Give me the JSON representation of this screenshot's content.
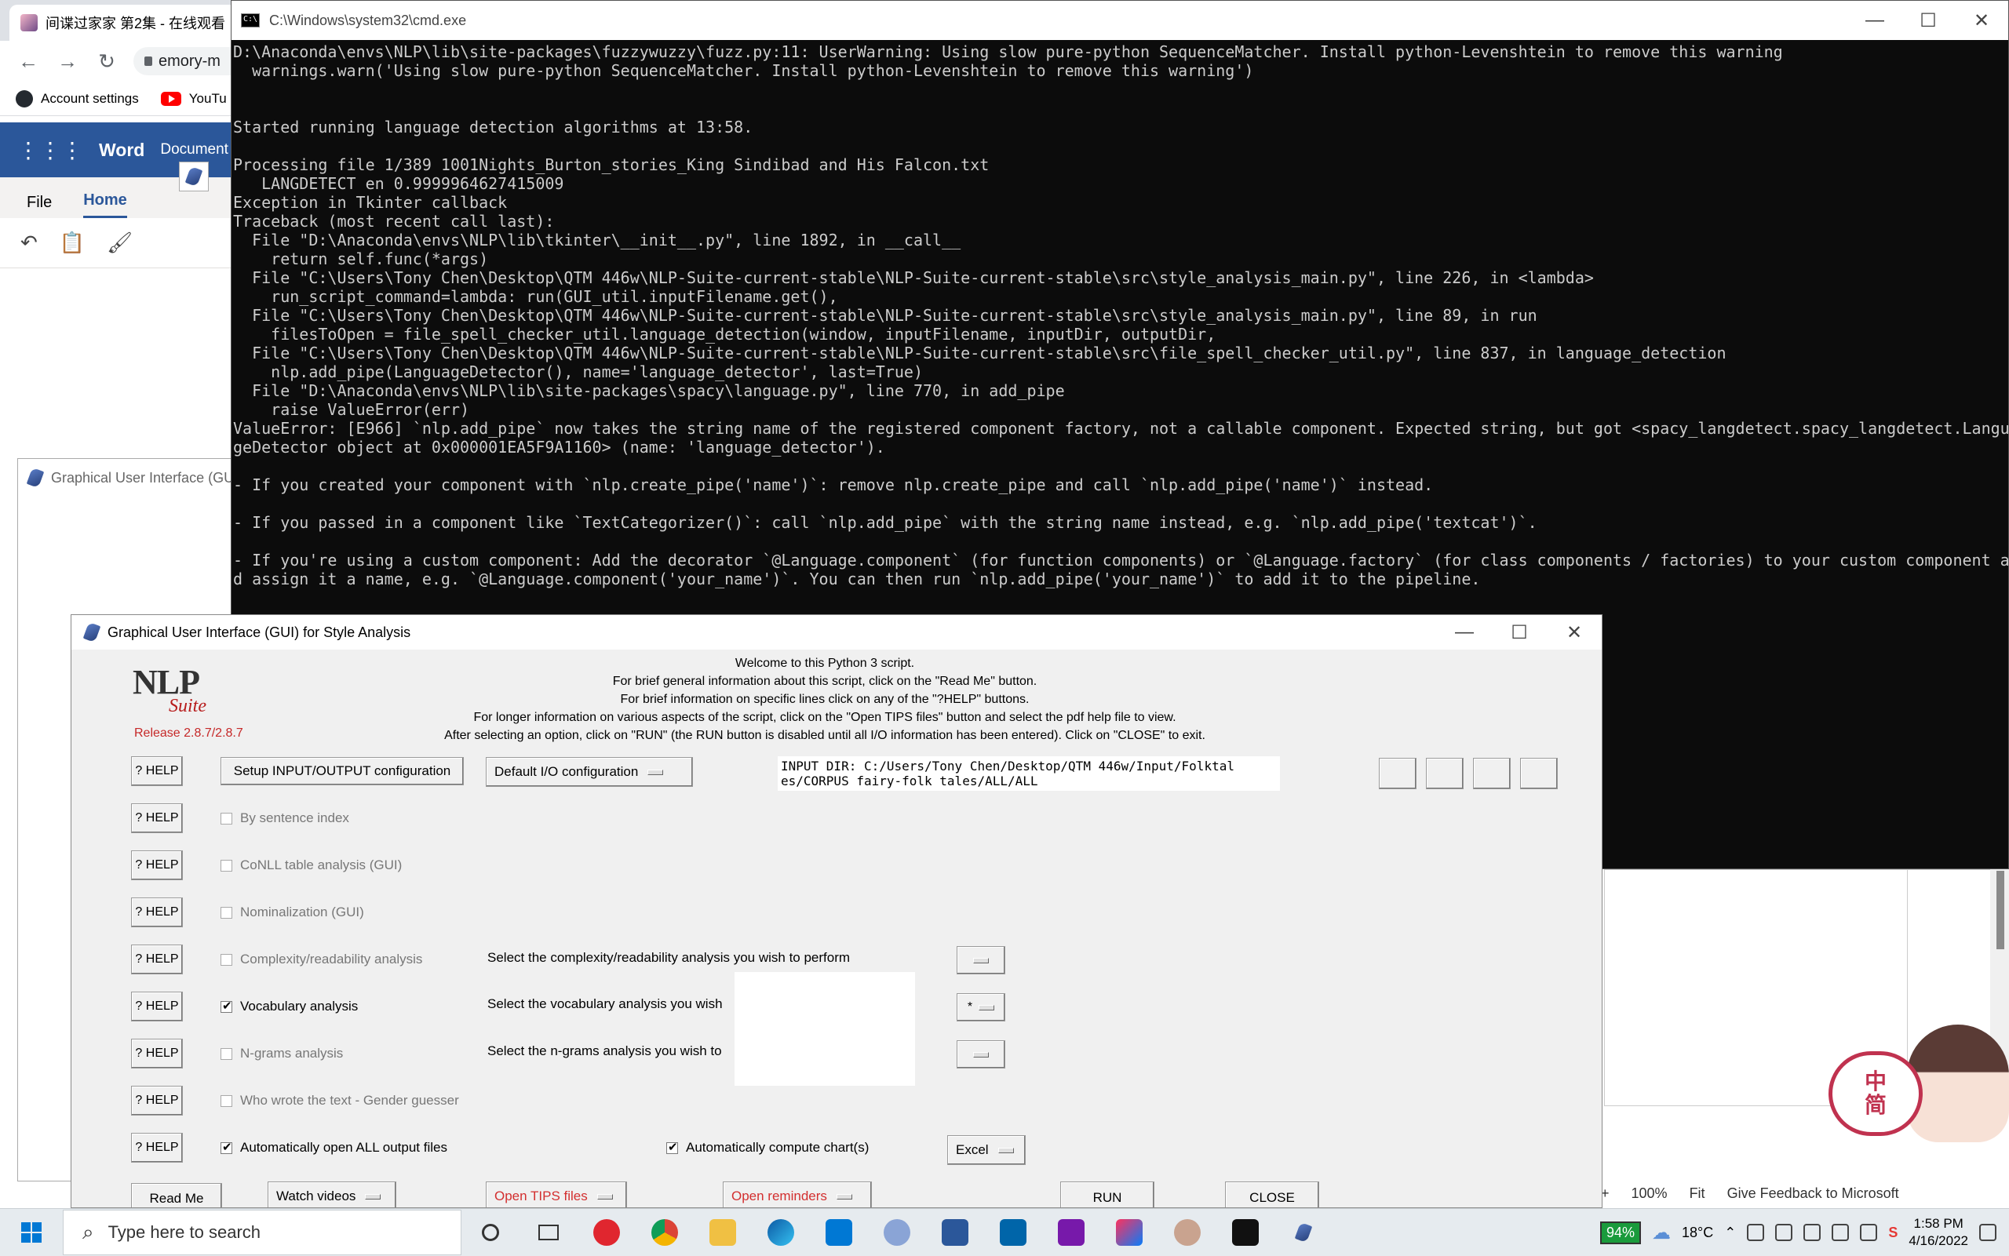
{
  "browser": {
    "tab_title": "间谍过家家 第2集 - 在线观看",
    "address": "emory-m",
    "bookmarks": [
      "Account settings",
      "YouTu"
    ]
  },
  "word": {
    "app_name": "Word",
    "doc_name": "Document",
    "tabs": [
      "File",
      "Home"
    ],
    "zoom": "100%",
    "fit": "Fit",
    "feedback": "Give Feedback to Microsoft",
    "plus": "+"
  },
  "mini_gui": {
    "title": "Graphical User Interface (GUI)"
  },
  "cmd": {
    "title": "C:\\Windows\\system32\\cmd.exe",
    "lines": [
      "D:\\Anaconda\\envs\\NLP\\lib\\site-packages\\fuzzywuzzy\\fuzz.py:11: UserWarning: Using slow pure-python SequenceMatcher. Install python-Levenshtein to remove this warning",
      "  warnings.warn('Using slow pure-python SequenceMatcher. Install python-Levenshtein to remove this warning')",
      "",
      "",
      "Started running language detection algorithms at 13:58.",
      "",
      "Processing file 1/389 1001Nights_Burton_stories_King Sindibad and His Falcon.txt",
      "   LANGDETECT en 0.9999964627415009",
      "Exception in Tkinter callback",
      "Traceback (most recent call last):",
      "  File \"D:\\Anaconda\\envs\\NLP\\lib\\tkinter\\__init__.py\", line 1892, in __call__",
      "    return self.func(*args)",
      "  File \"C:\\Users\\Tony Chen\\Desktop\\QTM 446w\\NLP-Suite-current-stable\\NLP-Suite-current-stable\\src\\style_analysis_main.py\", line 226, in <lambda>",
      "    run_script_command=lambda: run(GUI_util.inputFilename.get(),",
      "  File \"C:\\Users\\Tony Chen\\Desktop\\QTM 446w\\NLP-Suite-current-stable\\NLP-Suite-current-stable\\src\\style_analysis_main.py\", line 89, in run",
      "    filesToOpen = file_spell_checker_util.language_detection(window, inputFilename, inputDir, outputDir,",
      "  File \"C:\\Users\\Tony Chen\\Desktop\\QTM 446w\\NLP-Suite-current-stable\\NLP-Suite-current-stable\\src\\file_spell_checker_util.py\", line 837, in language_detection",
      "    nlp.add_pipe(LanguageDetector(), name='language_detector', last=True)",
      "  File \"D:\\Anaconda\\envs\\NLP\\lib\\site-packages\\spacy\\language.py\", line 770, in add_pipe",
      "    raise ValueError(err)",
      "ValueError: [E966] `nlp.add_pipe` now takes the string name of the registered component factory, not a callable component. Expected string, but got <spacy_langdetect.spacy_langdetect.Langua",
      "geDetector object at 0x000001EA5F9A1160> (name: 'language_detector').",
      "",
      "- If you created your component with `nlp.create_pipe('name')`: remove nlp.create_pipe and call `nlp.add_pipe('name')` instead.",
      "",
      "- If you passed in a component like `TextCategorizer()`: call `nlp.add_pipe` with the string name instead, e.g. `nlp.add_pipe('textcat')`.",
      "",
      "- If you're using a custom component: Add the decorator `@Language.component` (for function components) or `@Language.factory` (for class components / factories) to your custom component an",
      "d assign it a name, e.g. `@Language.component('your_name')`. You can then run `nlp.add_pipe('your_name')` to add it to the pipeline."
    ]
  },
  "gui": {
    "title": "Graphical User Interface (GUI) for Style Analysis",
    "logo_main": "NLP",
    "logo_sub": "Suite",
    "release": "Release 2.8.7/2.8.7",
    "welcome": [
      "Welcome to this Python 3 script.",
      "For brief general information about this script, click on the \"Read Me\" button.",
      "For brief information on specific lines click on any of the \"?HELP\" buttons.",
      "For longer information on various aspects of the script, click on the \"Open TIPS files\" button and select the pdf help file to view.",
      "After selecting an option, click on \"RUN\" (the RUN button is disabled until all I/O information has been entered).  Click on \"CLOSE\" to exit."
    ],
    "help_label": "? HELP",
    "setup_io": "Setup INPUT/OUTPUT configuration",
    "default_io": "Default I/O configuration",
    "input_dir": "INPUT DIR: C:/Users/Tony Chen/Desktop/QTM 446w/Input/Folktal\nes/CORPUS fairy-folk tales/ALL/ALL",
    "options": [
      {
        "label": "By sentence index",
        "checked": false,
        "enabled": false
      },
      {
        "label": "CoNLL table analysis (GUI)",
        "checked": false,
        "enabled": false
      },
      {
        "label": "Nominalization (GUI)",
        "checked": false,
        "enabled": false
      },
      {
        "label": "Complexity/readability analysis",
        "checked": false,
        "enabled": false
      },
      {
        "label": "Vocabulary analysis",
        "checked": true,
        "enabled": true
      },
      {
        "label": "N-grams analysis",
        "checked": false,
        "enabled": false
      },
      {
        "label": "Who wrote the text - Gender guesser",
        "checked": false,
        "enabled": false
      },
      {
        "label": "Automatically open ALL output files",
        "checked": true,
        "enabled": true
      }
    ],
    "select_complexity": "Select the complexity/readability analysis you wish to perform",
    "select_vocabulary": "Select the vocabulary analysis you wish",
    "select_ngrams": "Select the n-grams analysis you wish to",
    "vocab_menu_value": "*",
    "auto_chart": "Automatically compute chart(s)",
    "chart_menu_value": "Excel",
    "read_me": "Read Me",
    "watch_videos": "Watch videos",
    "open_tips": "Open TIPS files",
    "open_reminders": "Open reminders",
    "run": "RUN",
    "close": "CLOSE"
  },
  "mascot": {
    "line1": "中",
    "line2": "简"
  },
  "taskbar": {
    "search_placeholder": "Type here to search",
    "battery": "94%",
    "temperature": "18°C",
    "time": "1:58 PM",
    "date": "4/16/2022"
  },
  "colors": {
    "word_blue": "#2b579a",
    "cmd_bg": "#0c0c0c",
    "release_red": "#c62828",
    "battery_green": "#1a9b3c"
  }
}
